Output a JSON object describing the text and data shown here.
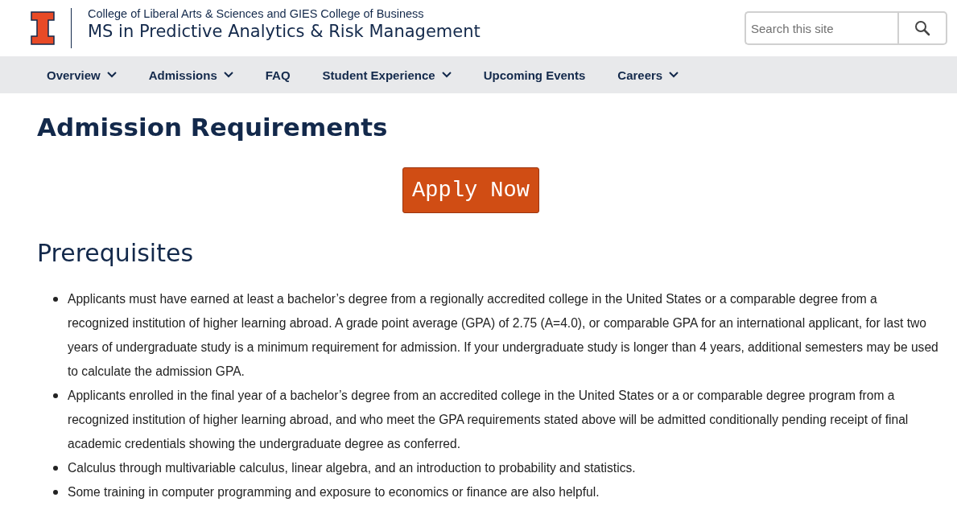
{
  "header": {
    "college": "College of Liberal Arts & Sciences and GIES College of Business",
    "title": "MS in Predictive Analytics & Risk Management",
    "search": {
      "placeholder": "Search this site"
    }
  },
  "nav": [
    {
      "label": "Overview",
      "dropdown": true
    },
    {
      "label": "Admissions",
      "dropdown": true
    },
    {
      "label": "FAQ",
      "dropdown": false
    },
    {
      "label": "Student Experience",
      "dropdown": true
    },
    {
      "label": "Upcoming Events",
      "dropdown": false
    },
    {
      "label": "Careers",
      "dropdown": true
    }
  ],
  "page_title": "Admission Requirements",
  "apply_button": "Apply Now",
  "section_title": "Prerequisites",
  "prerequisites": [
    "Applicants must have earned at least a bachelor’s degree from a regionally accredited college in the United States or a comparable degree from a recognized institution of higher learning abroad. A grade point average (GPA) of 2.75 (A=4.0), or comparable GPA for an international applicant, for last two years of undergraduate study is a minimum requirement for admission. If your undergraduate study is longer than 4 years, additional semesters may be used to calculate the admission GPA.",
    "Applicants enrolled in the final year of a bachelor’s degree from an accredited college in the United States or a or comparable degree program from a recognized institution of higher learning abroad, and who meet the GPA requirements stated above will be admitted conditionally pending receipt of final academic credentials showing the undergraduate degree as conferred.",
    "Calculus through multivariable calculus, linear algebra, and an introduction to probability and statistics.",
    "Some training in computer programming and exposure to economics or finance are also helpful."
  ]
}
